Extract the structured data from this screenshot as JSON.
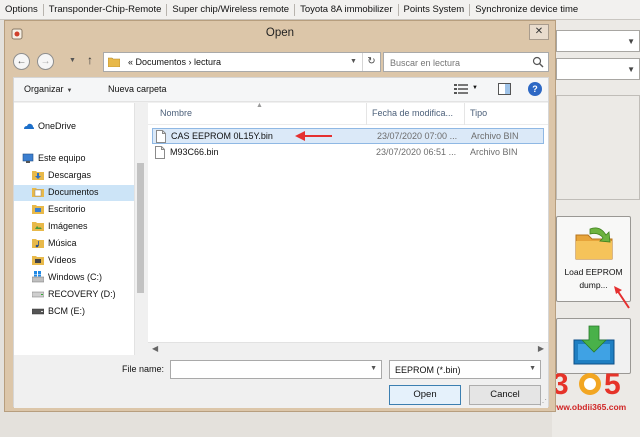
{
  "app": {
    "menu": [
      "Options",
      "Transponder-Chip-Remote",
      "Super chip/Wireless remote",
      "Toyota 8A immobilizer",
      "Points System",
      "Synchronize device time"
    ],
    "load_tile_label_1": "Load EEPROM",
    "load_tile_label_2": "dump..."
  },
  "watermark": {
    "url": "www.obdii365.com"
  },
  "dialog": {
    "title": "Open",
    "close_glyph": "✕",
    "address": {
      "breadcrumb": "«  Documentos  ›  lectura"
    },
    "search": {
      "placeholder": "Buscar en lectura"
    },
    "toolbar": {
      "organize": "Organizar",
      "new_folder": "Nueva carpeta",
      "help": "?"
    },
    "nav_items": [
      {
        "label": "OneDrive",
        "icon": "onedrive-icon"
      },
      {
        "label": "Este equipo",
        "icon": "computer-icon"
      },
      {
        "label": "Descargas",
        "icon": "downloads-folder-icon"
      },
      {
        "label": "Documentos",
        "icon": "documents-folder-icon"
      },
      {
        "label": "Escritorio",
        "icon": "desktop-folder-icon"
      },
      {
        "label": "Imágenes",
        "icon": "pictures-folder-icon"
      },
      {
        "label": "Música",
        "icon": "music-folder-icon"
      },
      {
        "label": "Vídeos",
        "icon": "videos-folder-icon"
      },
      {
        "label": "Windows (C:)",
        "icon": "windows-drive-icon"
      },
      {
        "label": "RECOVERY (D:)",
        "icon": "drive-icon"
      },
      {
        "label": "BCM (E:)",
        "icon": "drive-icon"
      }
    ],
    "columns": [
      "Nombre",
      "Fecha de modifica...",
      "Tipo"
    ],
    "files": [
      {
        "name": "CAS EEPROM 0L15Y.bin",
        "date": "23/07/2020 07:00 ...",
        "type": "Archivo BIN"
      },
      {
        "name": "M93C66.bin",
        "date": "23/07/2020 06:51 ...",
        "type": "Archivo BIN"
      }
    ],
    "file_name_label": "File name:",
    "file_name_value": "",
    "filter": "EEPROM (*.bin)",
    "open_button": "Open",
    "cancel_button": "Cancel"
  },
  "colors": {
    "annotation_arrow": "#e53030",
    "dialog_frame": "#dcc6a9",
    "selection": "#dbe9f8"
  }
}
